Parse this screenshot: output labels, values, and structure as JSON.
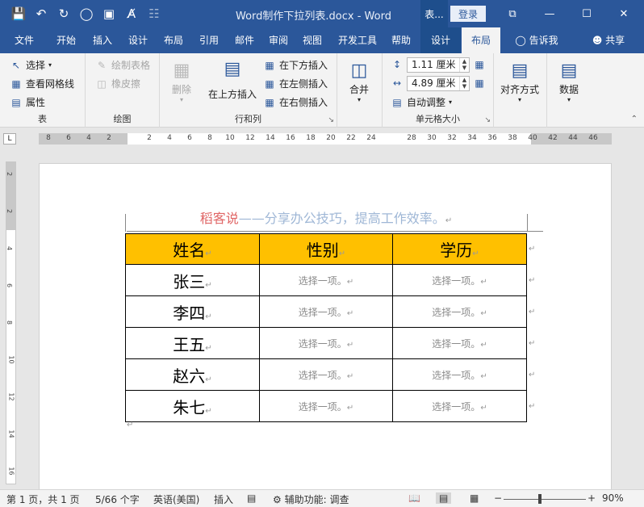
{
  "window": {
    "title": "Word制作下拉列表.docx  -  Word",
    "table_tools_label": "表...",
    "login_label": "登录",
    "controls": [
      "⧉",
      "—",
      "☐",
      "✕"
    ]
  },
  "quick_access": [
    "save-icon",
    "undo-icon",
    "redo-icon",
    "circle-icon",
    "form-icon",
    "font-icon",
    "touch-mode-icon"
  ],
  "tabs": [
    {
      "label": "文件"
    },
    {
      "label": "开始"
    },
    {
      "label": "插入"
    },
    {
      "label": "设计"
    },
    {
      "label": "布局"
    },
    {
      "label": "引用"
    },
    {
      "label": "邮件"
    },
    {
      "label": "审阅"
    },
    {
      "label": "视图"
    },
    {
      "label": "开发工具"
    },
    {
      "label": "帮助"
    },
    {
      "label": "设计"
    },
    {
      "label": "布局"
    }
  ],
  "tell_me": "告诉我",
  "share": "共享",
  "ribbon": {
    "table_group": {
      "label": "表",
      "select": "选择",
      "view_gridlines": "查看网格线",
      "properties": "属性"
    },
    "draw_group": {
      "label": "绘图",
      "draw_table": "绘制表格",
      "eraser": "橡皮擦"
    },
    "rows_cols_group": {
      "label": "行和列",
      "delete": "删除",
      "insert_above": "在上方插入",
      "insert_below": "在下方插入",
      "insert_left": "在左侧插入",
      "insert_right": "在右侧插入"
    },
    "merge_group": {
      "label": "合并"
    },
    "cell_size_group": {
      "label": "单元格大小",
      "height": "1.11 厘米",
      "width": "4.89 厘米",
      "autofit": "自动调整"
    },
    "align_group": {
      "label": "对齐方式"
    },
    "data_group": {
      "label": "数据"
    }
  },
  "ruler": {
    "h_numbers": [
      "8",
      "6",
      "4",
      "2",
      "",
      "2",
      "4",
      "6",
      "8",
      "10",
      "12",
      "14",
      "16",
      "18",
      "20",
      "22",
      "24",
      "",
      "28",
      "30",
      "32",
      "34",
      "36",
      "38",
      "40",
      "42",
      "44",
      "46"
    ],
    "v_numbers": [
      "2",
      "",
      "2",
      "",
      "4",
      "",
      "6",
      "",
      "8",
      "",
      "10",
      "",
      "12",
      "",
      "14",
      "",
      "16"
    ]
  },
  "document": {
    "header_brand": "稻客说",
    "header_slogan": "——分享办公技巧，提高工作效率。",
    "table": {
      "headers": [
        "姓名",
        "性别",
        "学历"
      ],
      "rows": [
        [
          "张三",
          "选择一项。",
          "选择一项。"
        ],
        [
          "李四",
          "选择一项。",
          "选择一项。"
        ],
        [
          "王五",
          "选择一项。",
          "选择一项。"
        ],
        [
          "赵六",
          "选择一项。",
          "选择一项。"
        ],
        [
          "朱七",
          "选择一项。",
          "选择一项。"
        ]
      ]
    },
    "paragraph_mark": "↵"
  },
  "status": {
    "page": "第 1 页，共 1 页",
    "words": "5/66 个字",
    "language": "英语(美国)",
    "mode": "插入",
    "accessibility": "辅助功能: 调查",
    "zoom": "90%",
    "zoom_minus": "−",
    "zoom_plus": "+"
  },
  "colors": {
    "title_bar": "#2b579a",
    "table_header": "#ffc000",
    "brand": "#e06666",
    "slogan": "#9fb7d6"
  }
}
